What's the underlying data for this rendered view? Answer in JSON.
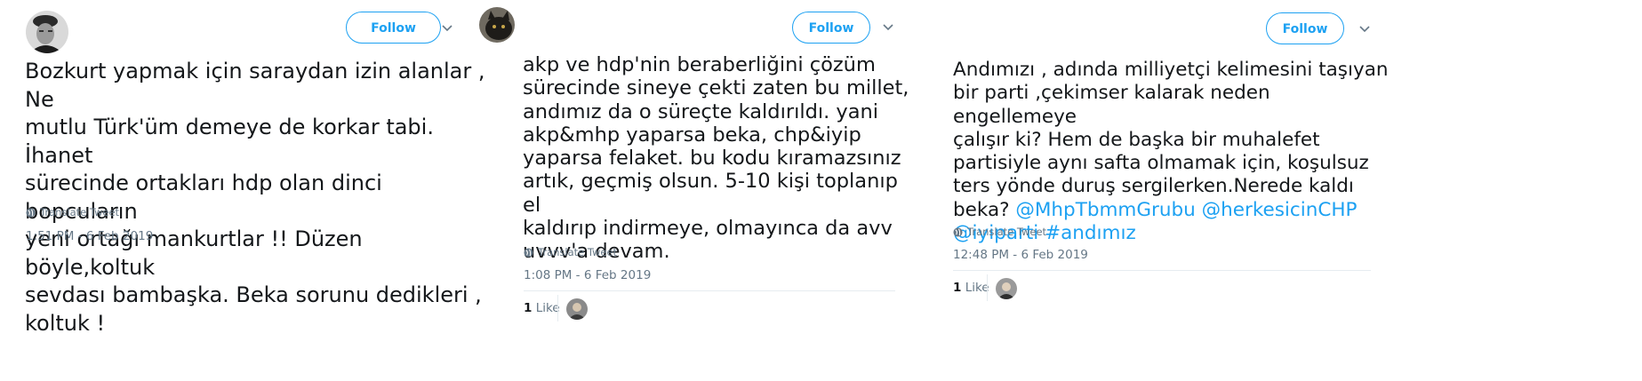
{
  "colors": {
    "accent": "#1da1f2",
    "meta": "#657786",
    "text": "#14171a",
    "divider": "#e6ecf0"
  },
  "tweets": [
    {
      "follow_label": "Follow",
      "text": "Bozkurt yapmak için saraydan izin alanlar , Ne\nmutlu Türk'üm demeye de korkar tabi. İhanet\nsürecinde ortakları hdp olan dinci bopcuların\nyeni ortağı mankurtlar !! Düzen böyle,koltuk\nsevdası bambaşka. Beka sorunu dedikleri ,\nkoltuk !",
      "translate_label": "Translate Tweet",
      "timestamp": "1:51 PM - 6 Feb 2019"
    },
    {
      "follow_label": "Follow",
      "text": "akp ve hdp'nin beraberliğini çözüm\nsürecinde sineye çekti zaten bu millet,\nandımız da o süreçte kaldırıldı. yani\nakp&mhp yaparsa beka, chp&iyip\nyaparsa felaket. bu kodu kıramazsınız\nartık, geçmiş olsun. 5-10 kişi toplanıp el\nkaldırıp indirmeye, olmayınca da avv\nuvvv'a devam.",
      "translate_label": "Translate Tweet",
      "timestamp": "1:08 PM - 6 Feb 2019",
      "like_count": "1",
      "like_label": "Like"
    },
    {
      "follow_label": "Follow",
      "text_plain": "Andımızı , adında milliyetçi kelimesini taşıyan\nbir parti ,çekimser kalarak neden engellemeye\nçalışır ki? Hem de başka bir muhalefet\npartisiyle aynı safta olmamak için, koşulsuz\nters yönde duruş sergilerken.Nerede kaldı\nbeka? ",
      "mention_1": "@MhpTbmmGrubu",
      "mention_2": "@herkesicinCHP",
      "mention_3": "@iyiparti",
      "hashtag": "#andımız",
      "translate_label": "Translate Tweet",
      "timestamp": "12:48 PM - 6 Feb 2019",
      "like_count": "1",
      "like_label": "Like"
    }
  ]
}
